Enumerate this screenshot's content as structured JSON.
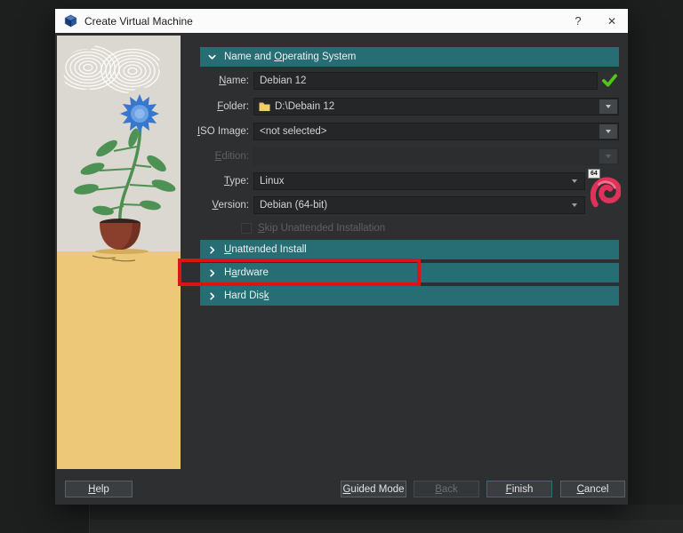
{
  "window": {
    "title": "Create Virtual Machine",
    "help": "?",
    "close": "✕"
  },
  "form": {
    "section_name_os": "Name and Operating System",
    "name_label": "Name:",
    "name_value": "Debian 12",
    "folder_label": "Folder:",
    "folder_value": "D:\\Debain 12",
    "iso_label": "ISO Image:",
    "iso_value": "<not selected>",
    "edition_label": "Edition:",
    "edition_value": "",
    "type_label": "Type:",
    "type_value": "Linux",
    "version_label": "Version:",
    "version_value": "Debian (64-bit)",
    "skip_unattended_label": "Skip Unattended Installation",
    "section_unattended": "Unattended Install",
    "section_hardware": "Hardware",
    "section_hard_disk": "Hard Disk",
    "os_badge": "64"
  },
  "buttons": {
    "help": "Help",
    "guided_mode": "Guided Mode",
    "back": "Back",
    "finish": "Finish",
    "cancel": "Cancel"
  },
  "colors": {
    "accent_teal": "#266d74",
    "highlight_red": "#dc1414",
    "valid_green": "#4ec718",
    "debian_pink": "#e0315b"
  }
}
